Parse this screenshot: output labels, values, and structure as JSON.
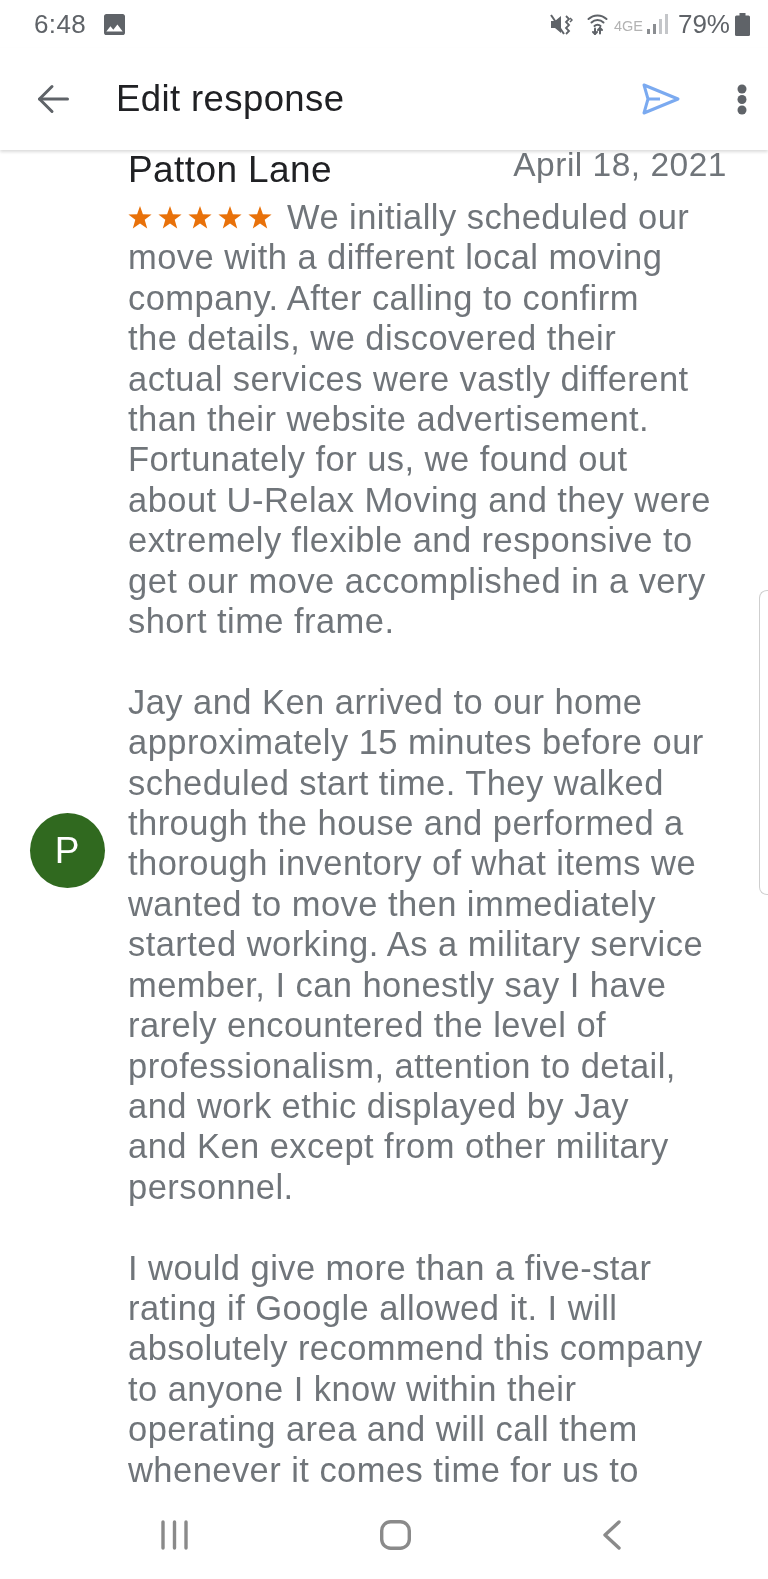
{
  "status_bar": {
    "time": "6:48",
    "network": "4GE",
    "battery": "79%"
  },
  "app_bar": {
    "title": "Edit response"
  },
  "review": {
    "avatar_letter": "P",
    "author": "Patton Lane",
    "date": "April 18, 2021",
    "stars": 5,
    "paragraphs": [
      [
        "We initially scheduled our",
        "move with a different local moving",
        "company. After calling to confirm",
        "the details, we discovered their",
        "actual services were vastly different",
        "than their website advertisement.",
        "Fortunately for us, we found out",
        "about U-Relax Moving and they were",
        "extremely flexible and responsive to",
        "get our move accomplished in a very",
        "short time frame."
      ],
      [
        "Jay and Ken arrived to our home",
        "approximately 15 minutes before our",
        "scheduled start time. They walked",
        "through the house and performed a",
        "thorough inventory of what items we",
        "wanted to move then immediately",
        "started working. As a military service",
        "member, I can honestly say I have",
        "rarely encountered the level of",
        "professionalism, attention to detail,",
        "and work ethic displayed by Jay",
        "and Ken except from other military",
        "personnel."
      ],
      [
        "I would give more than a five-star",
        "rating if Google allowed it. I will",
        "absolutely recommend this company",
        "to anyone I know within their",
        "operating area and will call them",
        "whenever it comes time for us to"
      ]
    ]
  }
}
